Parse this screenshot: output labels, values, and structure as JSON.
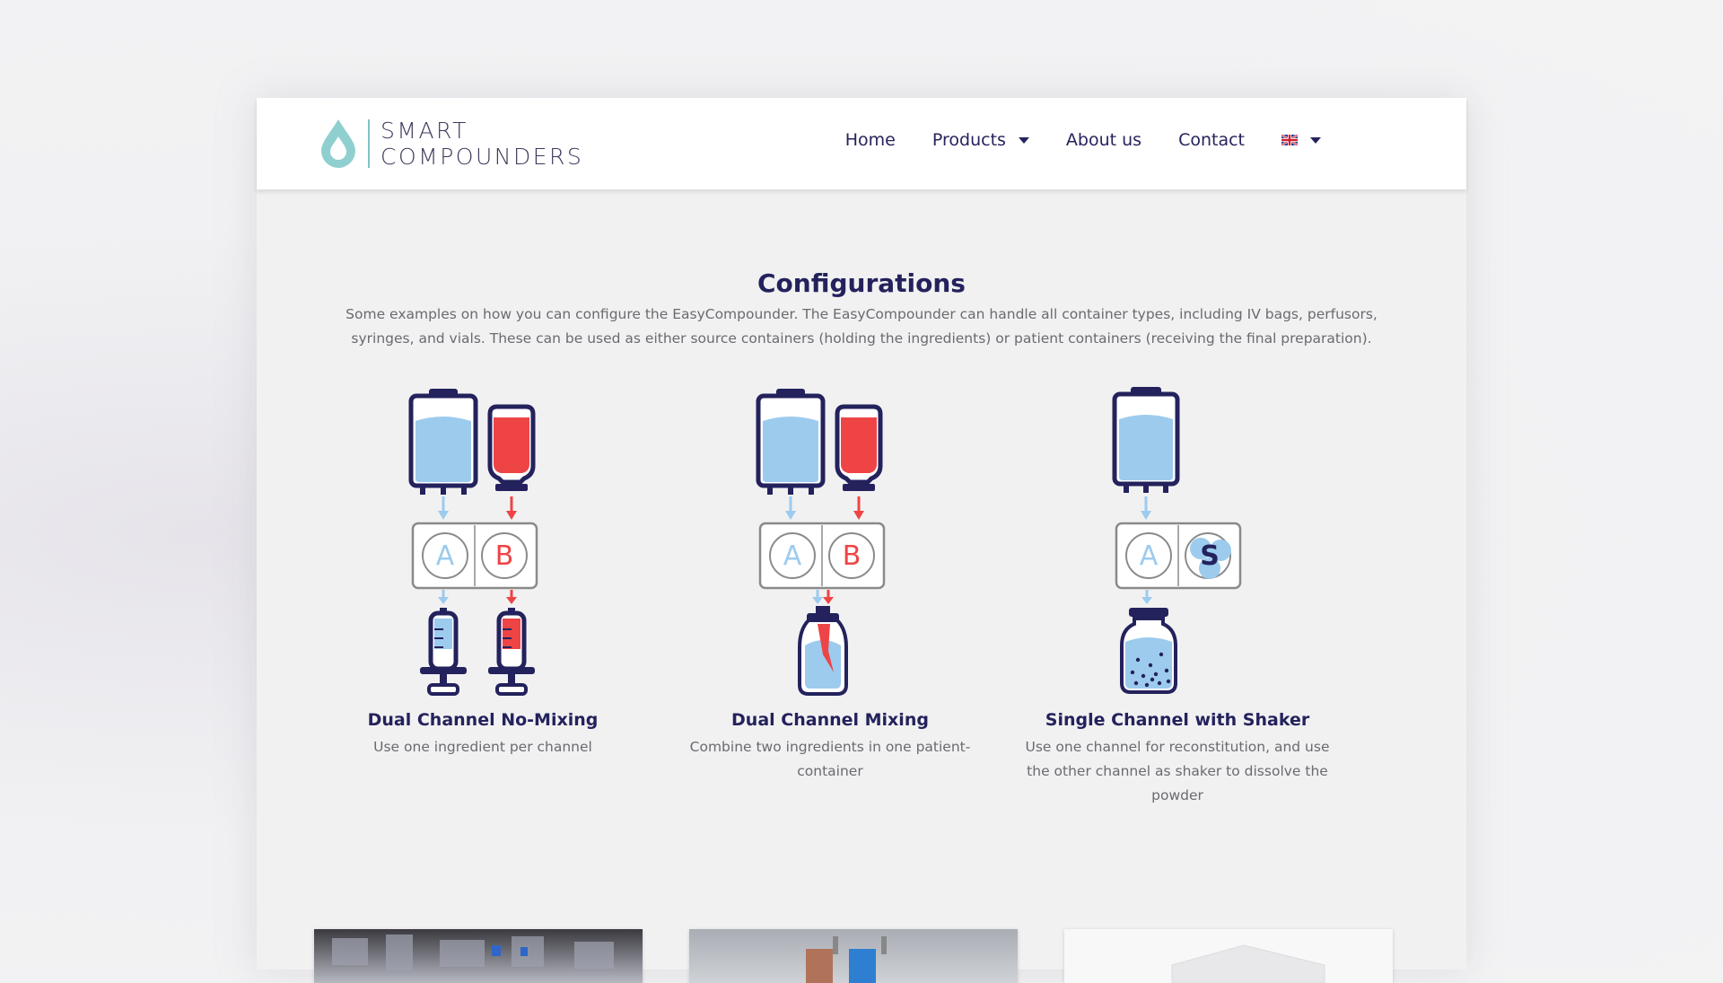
{
  "brand": {
    "line1": "SMART",
    "line2": "COMPOUNDERS",
    "accent": "#7fc3c4"
  },
  "nav": {
    "home": "Home",
    "products": "Products",
    "about": "About us",
    "contact": "Contact",
    "language_icon": "uk-flag-icon"
  },
  "section": {
    "title": "Configurations",
    "description": "Some examples on how you can configure the EasyCompounder. The EasyCompounder can handle all container types, including IV bags, perfusors, syringes, and vials. These can be used as either source containers (holding the ingredients) or patient containers (receiving the final preparation)."
  },
  "configs": [
    {
      "title": "Dual Channel No-Mixing",
      "description": "Use one ingredient per channel",
      "labels": [
        "A",
        "B"
      ]
    },
    {
      "title": "Dual Channel Mixing",
      "description": "Combine two ingredients in one patient-container",
      "labels": [
        "A",
        "B"
      ]
    },
    {
      "title": "Single Channel with Shaker",
      "description": "Use one channel for reconstitution, and use the other channel as shaker to dissolve the powder",
      "labels": [
        "A",
        "S"
      ]
    }
  ],
  "colors": {
    "navy": "#24225c",
    "blue": "#9ccbee",
    "red": "#ee4446",
    "grey": "#8a8a8a"
  }
}
